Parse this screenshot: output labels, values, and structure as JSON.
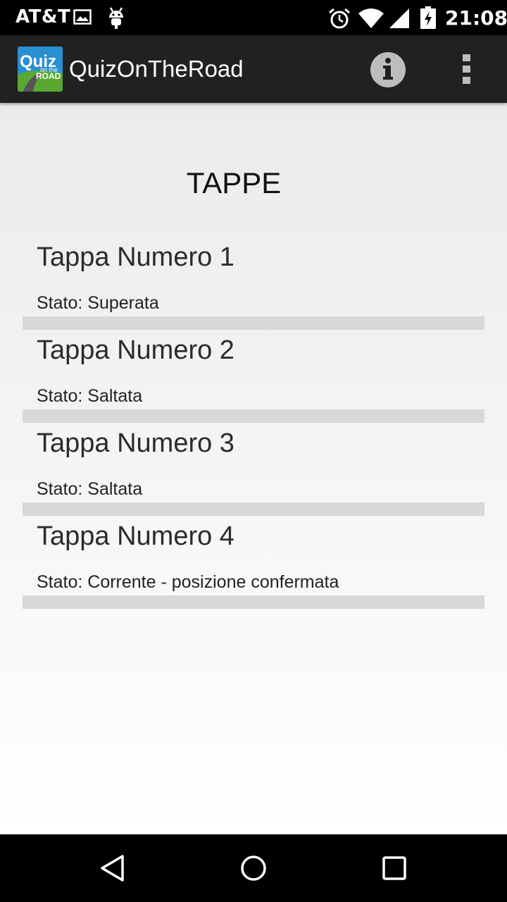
{
  "status_bar": {
    "carrier": "AT&T",
    "time": "21:08",
    "icons": [
      "image-icon",
      "android-debug-icon",
      "alarm-icon",
      "wifi-icon",
      "signal-icon",
      "battery-charging-icon"
    ]
  },
  "action_bar": {
    "title": "QuizOnTheRoad",
    "logo": {
      "line1": "Quiz",
      "line2": "on the",
      "line3": "ROAD"
    },
    "actions": [
      "info-icon",
      "overflow-menu-icon"
    ]
  },
  "main": {
    "heading": "TAPPE",
    "stages": [
      {
        "title": "Tappa Numero 1",
        "status": "Stato: Superata"
      },
      {
        "title": "Tappa Numero 2",
        "status": "Stato: Saltata"
      },
      {
        "title": "Tappa Numero 3",
        "status": "Stato: Saltata"
      },
      {
        "title": "Tappa Numero 4",
        "status": "Stato: Corrente - posizione confermata"
      }
    ]
  },
  "nav_bar": {
    "buttons": [
      "back-icon",
      "home-icon",
      "recents-icon"
    ]
  },
  "colors": {
    "status_bar_bg": "#000000",
    "action_bar_bg": "#212121",
    "divider": "#d8d8d8",
    "content_bg_top": "#ebebeb",
    "content_bg_bottom": "#ffffff"
  }
}
